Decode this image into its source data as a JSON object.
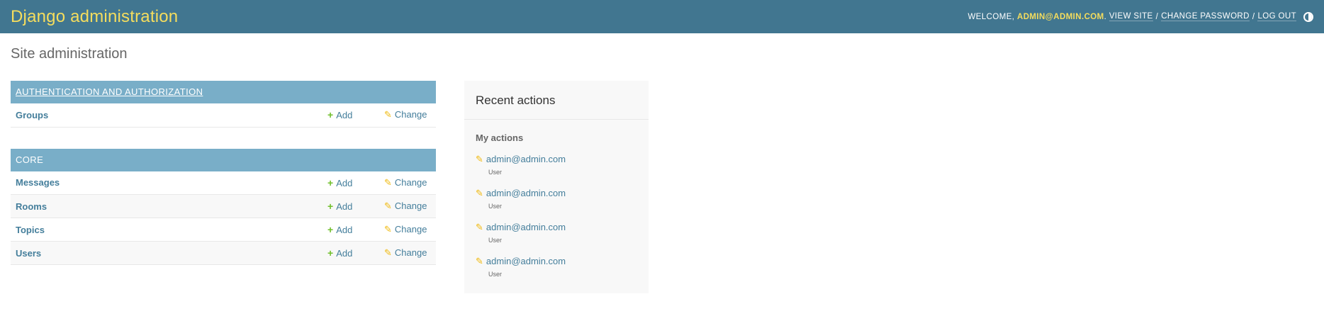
{
  "header": {
    "branding": "Django administration",
    "welcome_prefix": "WELCOME,",
    "username": "ADMIN@ADMIN.COM",
    "username_suffix": ".",
    "view_site": "VIEW SITE",
    "change_password": "CHANGE PASSWORD",
    "logout": "LOG OUT",
    "separator": "/"
  },
  "page": {
    "title": "Site administration"
  },
  "apps": [
    {
      "name": "AUTHENTICATION AND AUTHORIZATION",
      "models": [
        {
          "name": "Groups",
          "add": "Add",
          "change": "Change"
        }
      ]
    },
    {
      "name": "CORE",
      "models": [
        {
          "name": "Messages",
          "add": "Add",
          "change": "Change"
        },
        {
          "name": "Rooms",
          "add": "Add",
          "change": "Change"
        },
        {
          "name": "Topics",
          "add": "Add",
          "change": "Change"
        },
        {
          "name": "Users",
          "add": "Add",
          "change": "Change"
        }
      ]
    }
  ],
  "recent_actions": {
    "title": "Recent actions",
    "subtitle": "My actions",
    "items": [
      {
        "label": "admin@admin.com",
        "type": "User"
      },
      {
        "label": "admin@admin.com",
        "type": "User"
      },
      {
        "label": "admin@admin.com",
        "type": "User"
      },
      {
        "label": "admin@admin.com",
        "type": "User"
      }
    ]
  },
  "colors": {
    "header_bg": "#417690",
    "branding": "#f5dd5d",
    "caption_bg": "#79aec8",
    "link": "#447e9b",
    "add_icon": "#70bf2b",
    "change_icon": "#efb80b"
  },
  "icons": {
    "add": "plus-icon",
    "change": "pencil-icon",
    "theme": "theme-toggle-icon"
  }
}
